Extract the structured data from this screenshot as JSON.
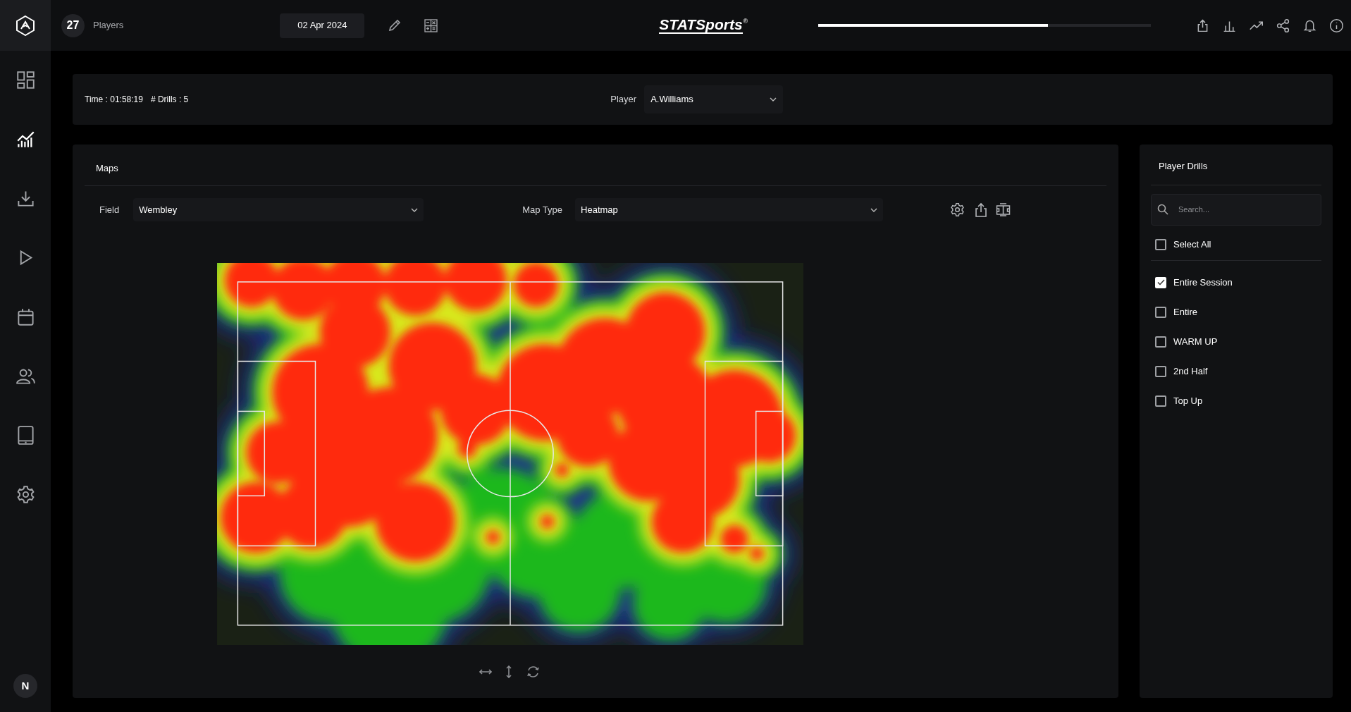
{
  "top_bar": {
    "player_count": "27",
    "players_label": "Players",
    "date": "02 Apr 2024",
    "logo": "STATSports",
    "registered_mark": "®",
    "progress": {
      "level": 0.69
    }
  },
  "sidebar": {
    "items": [
      {
        "kind": "dashboard",
        "selected": false
      },
      {
        "kind": "analytics",
        "selected": true
      },
      {
        "kind": "download",
        "selected": false
      },
      {
        "kind": "play",
        "selected": false
      },
      {
        "kind": "calendar",
        "selected": false
      },
      {
        "kind": "team",
        "selected": false
      },
      {
        "kind": "tablet",
        "selected": false
      },
      {
        "kind": "settings",
        "selected": false
      }
    ],
    "avatar": "N"
  },
  "session_info": {
    "time": "Time : 01:58:19",
    "drills": "# Drills : 5",
    "player_label": "Player",
    "player_value": "A.Williams"
  },
  "maps": {
    "title": "Maps",
    "field_label": "Field",
    "field_value": "Wembley",
    "map_type_label": "Map Type",
    "map_type_value": "Heatmap"
  },
  "player_drills": {
    "title": "Player Drills",
    "search_placeholder": "Search...",
    "select_all": {
      "label": "Select All",
      "checked": false
    },
    "drills": [
      {
        "label": "Entire Session",
        "checked": true
      },
      {
        "label": "Entire",
        "checked": false
      },
      {
        "label": "WARM UP",
        "checked": false
      },
      {
        "label": "2nd Half",
        "checked": false
      },
      {
        "label": "Top Up",
        "checked": false
      }
    ]
  }
}
